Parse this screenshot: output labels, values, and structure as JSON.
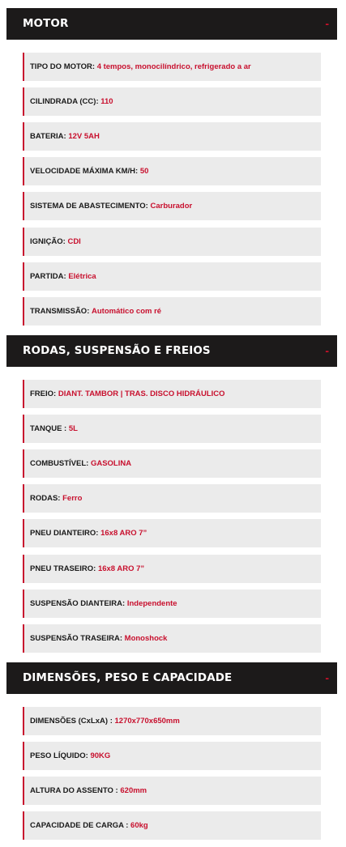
{
  "colors": {
    "header_bg": "#1c1a1a",
    "accent": "#c8102e",
    "row_bg": "#ebebeb"
  },
  "sections": [
    {
      "title": "MOTOR",
      "toggle": "-",
      "items": [
        {
          "label": "TIPO DO MOTOR:",
          "value": "4 tempos, monocilíndrico, refrigerado a ar"
        },
        {
          "label": "CILINDRADA (CC):",
          "value": "110"
        },
        {
          "label": "BATERIA:",
          "value": "12V 5AH"
        },
        {
          "label": "VELOCIDADE MÁXIMA KM/H:",
          "value": "50"
        },
        {
          "label": "SISTEMA DE ABASTECIMENTO:",
          "value": "Carburador"
        },
        {
          "label": "IGNIÇÃO:",
          "value": "CDI"
        },
        {
          "label": "PARTIDA:",
          "value": "Elétrica"
        },
        {
          "label": "TRANSMISSÃO:",
          "value": "Automático com ré"
        }
      ]
    },
    {
      "title": "RODAS, SUSPENSÃO E FREIOS",
      "toggle": "-",
      "items": [
        {
          "label": "FREIO:",
          "value": "DIANT. TAMBOR | TRAS. DISCO HIDRÁULICO"
        },
        {
          "label": "TANQUE :",
          "value": "5L"
        },
        {
          "label": "COMBUSTÍVEL:",
          "value": "GASOLINA"
        },
        {
          "label": "RODAS:",
          "value": "Ferro"
        },
        {
          "label": "PNEU DIANTEIRO:",
          "value": "16x8 ARO 7”"
        },
        {
          "label": "PNEU TRASEIRO:",
          "value": "16x8 ARO 7”"
        },
        {
          "label": "SUSPENSÃO DIANTEIRA:",
          "value": "Independente"
        },
        {
          "label": "SUSPENSÃO TRASEIRA:",
          "value": "Monoshock"
        }
      ]
    },
    {
      "title": "DIMENSÕES, PESO E CAPACIDADE",
      "toggle": "-",
      "items": [
        {
          "label": "DIMENSÕES (CxLxA) :",
          "value": "1270x770x650mm"
        },
        {
          "label": "PESO LÍQUIDO:",
          "value": "90KG"
        },
        {
          "label": "ALTURA DO ASSENTO :",
          "value": "620mm"
        },
        {
          "label": "CAPACIDADE DE CARGA :",
          "value": "60kg"
        }
      ]
    }
  ]
}
